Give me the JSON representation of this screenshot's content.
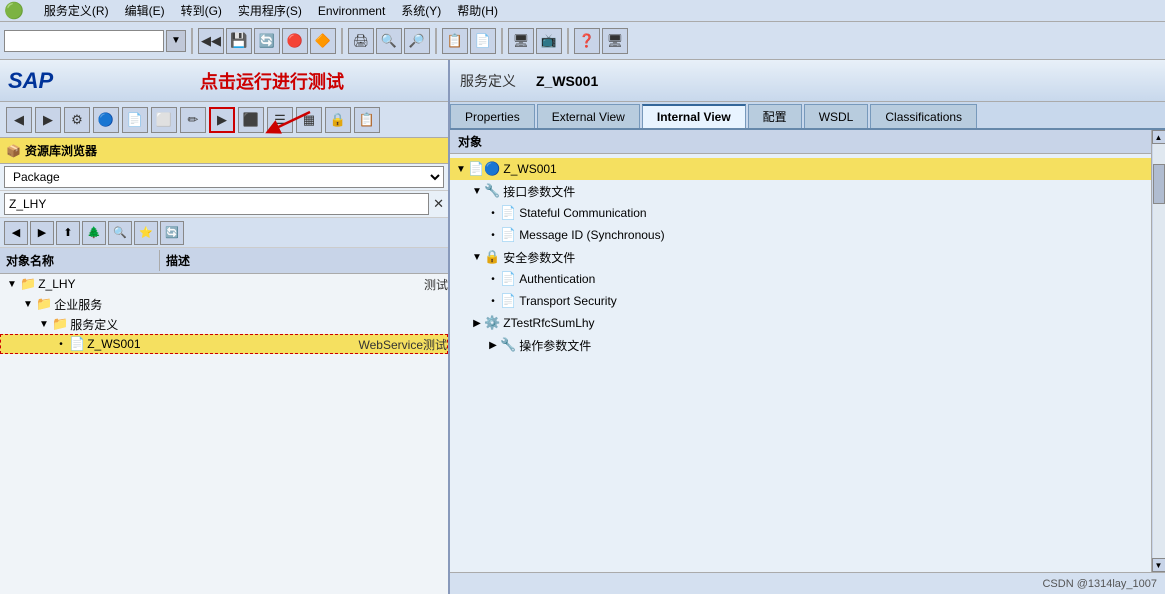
{
  "menubar": {
    "items": [
      {
        "label": "服务定义(R)"
      },
      {
        "label": "编辑(E)"
      },
      {
        "label": "转到(G)"
      },
      {
        "label": "实用程序(S)"
      },
      {
        "label": "Environment"
      },
      {
        "label": "系统(Y)"
      },
      {
        "label": "帮助(H)"
      }
    ]
  },
  "annotation": {
    "text": "点击运行进行测试",
    "arrow": "→"
  },
  "left_panel": {
    "resource_header": "资源库浏览器",
    "package_label": "Package",
    "search_value": "Z_LHY",
    "obj_col_name": "对象名称",
    "obj_col_desc": "描述",
    "tree": [
      {
        "indent": 0,
        "expand": "▼",
        "icon": "📁",
        "label": "Z_LHY",
        "desc": "测试",
        "selected": false
      },
      {
        "indent": 1,
        "expand": "▼",
        "icon": "📁",
        "label": "企业服务",
        "desc": "",
        "selected": false
      },
      {
        "indent": 2,
        "expand": "▼",
        "icon": "📁",
        "label": "服务定义",
        "desc": "",
        "selected": false
      },
      {
        "indent": 3,
        "expand": "•",
        "icon": "📄",
        "label": "Z_WS001",
        "desc": "WebService测试",
        "selected": true
      }
    ]
  },
  "right_panel": {
    "service_def_label": "服务定义",
    "service_name": "Z_WS001",
    "tabs": [
      {
        "label": "Properties",
        "active": false
      },
      {
        "label": "External View",
        "active": false
      },
      {
        "label": "Internal View",
        "active": true
      },
      {
        "label": "配置",
        "active": false
      },
      {
        "label": "WSDL",
        "active": false
      },
      {
        "label": "Classifications",
        "active": false
      }
    ],
    "obj_section_label": "对象",
    "tree": [
      {
        "indent": 0,
        "expand": "▼",
        "icon": "📄🔵",
        "label": "Z_WS001",
        "highlighted": true,
        "isService": true
      },
      {
        "indent": 1,
        "expand": "▼",
        "icon": "🔧",
        "label": "接口参数文件",
        "highlighted": false
      },
      {
        "indent": 2,
        "expand": "•",
        "icon": "📄",
        "label": "Stateful Communication",
        "highlighted": false
      },
      {
        "indent": 2,
        "expand": "•",
        "icon": "📄",
        "label": "Message ID (Synchronous)",
        "highlighted": false
      },
      {
        "indent": 1,
        "expand": "▼",
        "icon": "🔒",
        "label": "安全参数文件",
        "highlighted": false
      },
      {
        "indent": 2,
        "expand": "•",
        "icon": "📄",
        "label": "Authentication",
        "highlighted": false
      },
      {
        "indent": 2,
        "expand": "•",
        "icon": "📄",
        "label": "Transport Security",
        "highlighted": false
      },
      {
        "indent": 1,
        "expand": "▶",
        "icon": "⚙️",
        "label": "ZTestRfcSumLhy",
        "highlighted": false
      },
      {
        "indent": 2,
        "expand": "▶",
        "icon": "🔧",
        "label": "操作参数文件",
        "highlighted": false
      }
    ]
  },
  "footer": {
    "credit": "CSDN @1314lay_1007"
  }
}
